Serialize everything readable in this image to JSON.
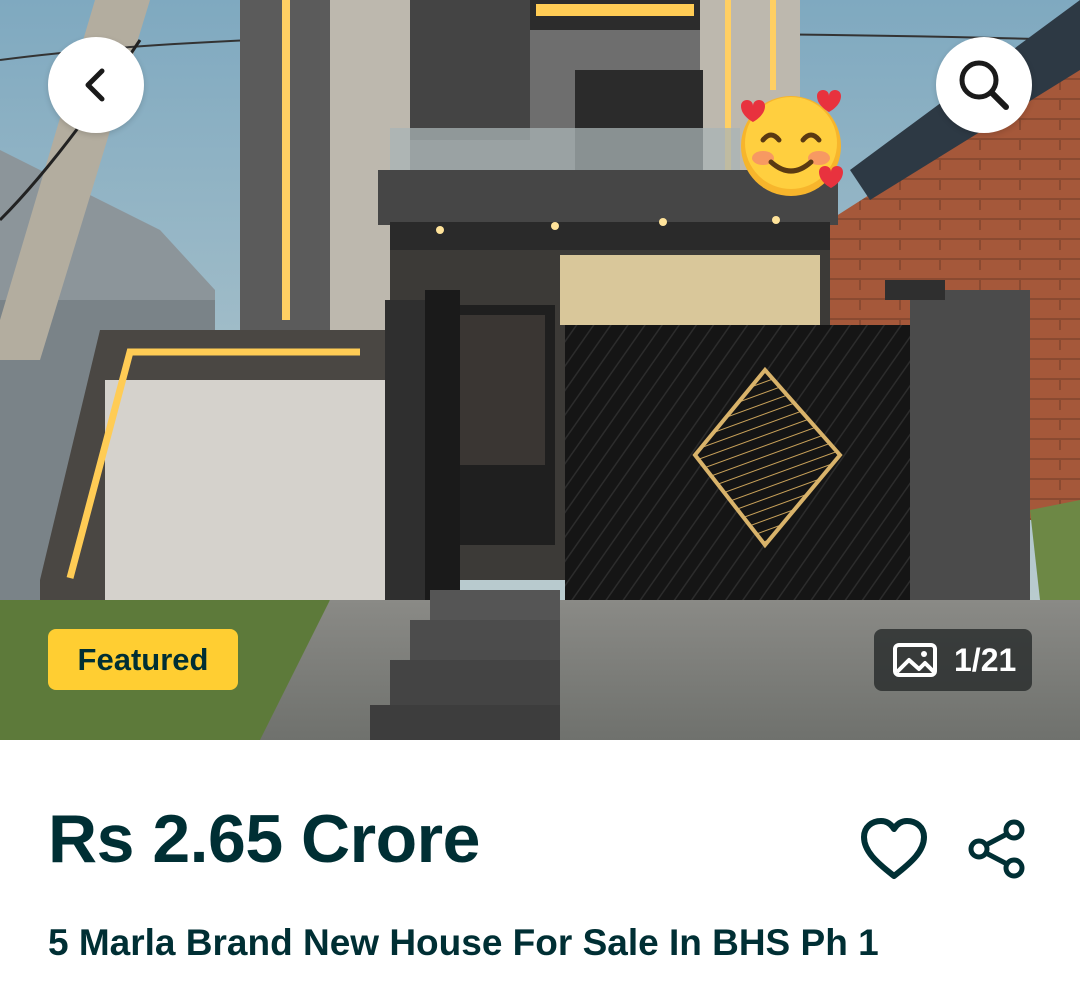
{
  "header": {
    "back_icon": "chevron-left-icon",
    "search_icon": "search-icon"
  },
  "gallery": {
    "badge_label": "Featured",
    "counter_icon": "image-icon",
    "counter_text": "1/21",
    "overlay_emoji": "smiling-face-with-hearts"
  },
  "listing": {
    "price": "Rs 2.65 Crore",
    "title": "5 Marla Brand New House For Sale In BHS Ph 1",
    "favorite_icon": "heart-icon",
    "share_icon": "share-icon"
  },
  "colors": {
    "text_primary": "#002f34",
    "badge_yellow": "#ffce32",
    "counter_bg": "#282c2c"
  }
}
